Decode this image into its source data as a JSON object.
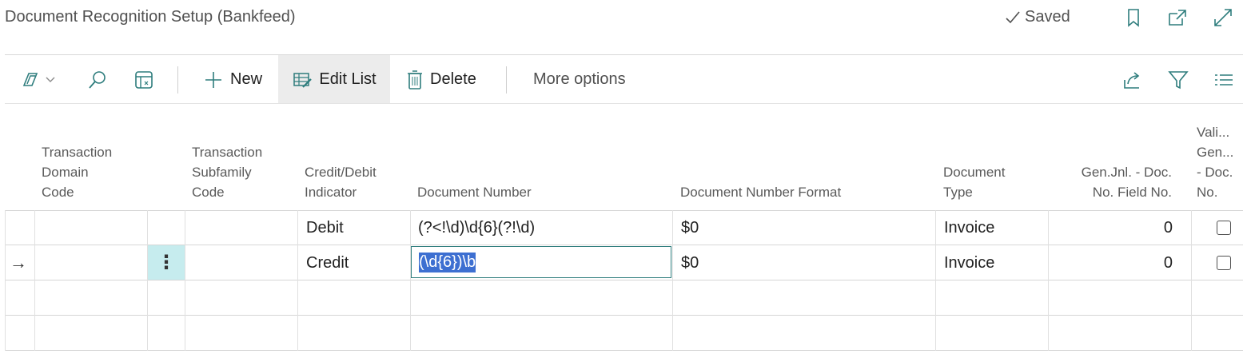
{
  "header": {
    "title": "Document Recognition Setup (Bankfeed)",
    "saved_label": "Saved",
    "icons": [
      "bookmark-icon",
      "open-new-window-icon",
      "expand-icon"
    ]
  },
  "actionbar": {
    "new_label": "New",
    "edit_list_label": "Edit List",
    "delete_label": "Delete",
    "more_options_label": "More options"
  },
  "grid": {
    "columns": [
      {
        "line1": "Transaction",
        "line2": "Domain",
        "line3": "Code"
      },
      {
        "line1": "Transaction",
        "line2": "Subfamily",
        "line3": "Code"
      },
      {
        "line1": "Credit/Debit",
        "line2": "Indicator"
      },
      {
        "line1": "Document Number"
      },
      {
        "line1": "Document Number Format"
      },
      {
        "line1": "Document",
        "line2": "Type"
      },
      {
        "line1": "Gen.Jnl. - Doc.",
        "line2": "No. Field No."
      },
      {
        "line1": "Vali...",
        "line2": "Gen...",
        "line3": "- Doc.",
        "line4": "No."
      }
    ],
    "rows": [
      {
        "indicator": "Debit",
        "document_number": "(?<!\\d)\\d{6}(?!\\d)",
        "format": "$0",
        "doc_type": "Invoice",
        "field_no": "0",
        "validate": false
      },
      {
        "indicator": "Credit",
        "document_number": "(\\d{6})\\b",
        "format": "$0",
        "doc_type": "Invoice",
        "field_no": "0",
        "validate": false
      }
    ]
  }
}
